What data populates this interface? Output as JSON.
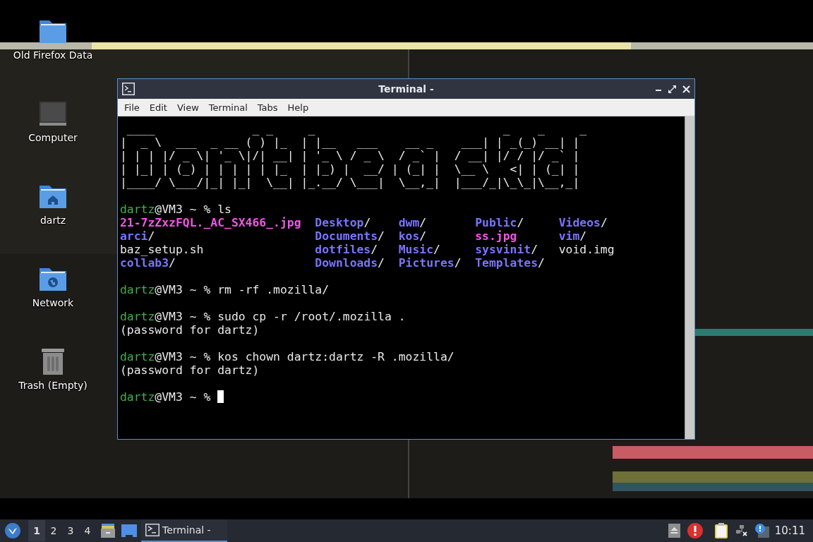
{
  "desktop": {
    "icons": [
      {
        "label": "Old Firefox Data",
        "kind": "folder"
      },
      {
        "label": "Computer",
        "kind": "computer"
      },
      {
        "label": "dartz",
        "kind": "home"
      },
      {
        "label": "Network",
        "kind": "network"
      },
      {
        "label": "Trash (Empty)",
        "kind": "trash"
      }
    ]
  },
  "window": {
    "title": "Terminal -",
    "menu": [
      "File",
      "Edit",
      "View",
      "Terminal",
      "Tabs",
      "Help"
    ],
    "banner": " ____              _ _     _                           _    _     _ \n|  _ \\  ___  _ __ ( ) |_  | |__   ___    __ _    ___| | _(_) __| |\n| | | |/ _ \\| '_ \\|/| __| | '_ \\ / _ \\  / _` |  / __| |/ / |/ _` |\n| |_| | (_) | | | | | |_  | |_) |  __/ | (_| |  \\__ \\   <| | (_| |\n|____/ \\___/|_| |_|  \\__| |_.__/ \\___|  \\__,_|  |___/_|\\_\\_|\\__,_|",
    "lines": [
      {
        "kind": "blank"
      },
      {
        "kind": "prompt",
        "user": "dartz",
        "host": "@VM3 ~ %",
        "command": "ls",
        "cursor": false
      },
      {
        "kind": "listing",
        "rows": [
          [
            {
              "name": "21-7zZxzFQL._AC_SX466_.jpg",
              "kind": "image"
            },
            {
              "name": "Desktop",
              "suffix": "/",
              "kind": "dir"
            },
            {
              "name": "dwm",
              "suffix": "/",
              "kind": "dir"
            },
            {
              "name": "Public",
              "suffix": "/",
              "kind": "dir"
            },
            {
              "name": "Videos",
              "suffix": "/",
              "kind": "dir"
            }
          ],
          [
            {
              "name": "arci",
              "suffix": "/",
              "kind": "dir"
            },
            {
              "name": "Documents",
              "suffix": "/",
              "kind": "dir"
            },
            {
              "name": "kos",
              "suffix": "/",
              "kind": "dir"
            },
            {
              "name": "ss.jpg",
              "kind": "image"
            },
            {
              "name": "vim",
              "suffix": "/",
              "kind": "dir"
            }
          ],
          [
            {
              "name": "baz_setup.sh",
              "kind": "file"
            },
            {
              "name": "dotfiles",
              "suffix": "/",
              "kind": "dir"
            },
            {
              "name": "Music",
              "suffix": "/",
              "kind": "dir"
            },
            {
              "name": "sysvinit",
              "suffix": "/",
              "kind": "dir"
            },
            {
              "name": "void.img",
              "kind": "file"
            }
          ],
          [
            {
              "name": "collab3",
              "suffix": "/",
              "kind": "dir"
            },
            {
              "name": "Downloads",
              "suffix": "/",
              "kind": "dir"
            },
            {
              "name": "Pictures",
              "suffix": "/",
              "kind": "dir"
            },
            {
              "name": "Templates",
              "suffix": "/",
              "kind": "dir"
            }
          ]
        ]
      },
      {
        "kind": "blank"
      },
      {
        "kind": "prompt",
        "user": "dartz",
        "host": "@VM3 ~ %",
        "command": "rm -rf .mozilla/",
        "cursor": false
      },
      {
        "kind": "blank"
      },
      {
        "kind": "prompt",
        "user": "dartz",
        "host": "@VM3 ~ %",
        "command": "sudo cp -r /root/.mozilla .",
        "cursor": false
      },
      {
        "kind": "output",
        "text": "(password for dartz)"
      },
      {
        "kind": "blank"
      },
      {
        "kind": "prompt",
        "user": "dartz",
        "host": "@VM3 ~ %",
        "command": "kos chown dartz:dartz -R .mozilla/",
        "cursor": false
      },
      {
        "kind": "output",
        "text": "(password for dartz)"
      },
      {
        "kind": "blank"
      },
      {
        "kind": "prompt",
        "user": "dartz",
        "host": "@VM3 ~ %",
        "cursor": true
      }
    ]
  },
  "taskbar": {
    "workspaces": [
      {
        "label": "1",
        "selected": true
      },
      {
        "label": "2",
        "selected": false
      },
      {
        "label": "3",
        "selected": false
      },
      {
        "label": "4",
        "selected": false
      }
    ],
    "tasks": [
      {
        "title": "Terminal -",
        "selected": true
      }
    ],
    "clock": "10:11"
  }
}
